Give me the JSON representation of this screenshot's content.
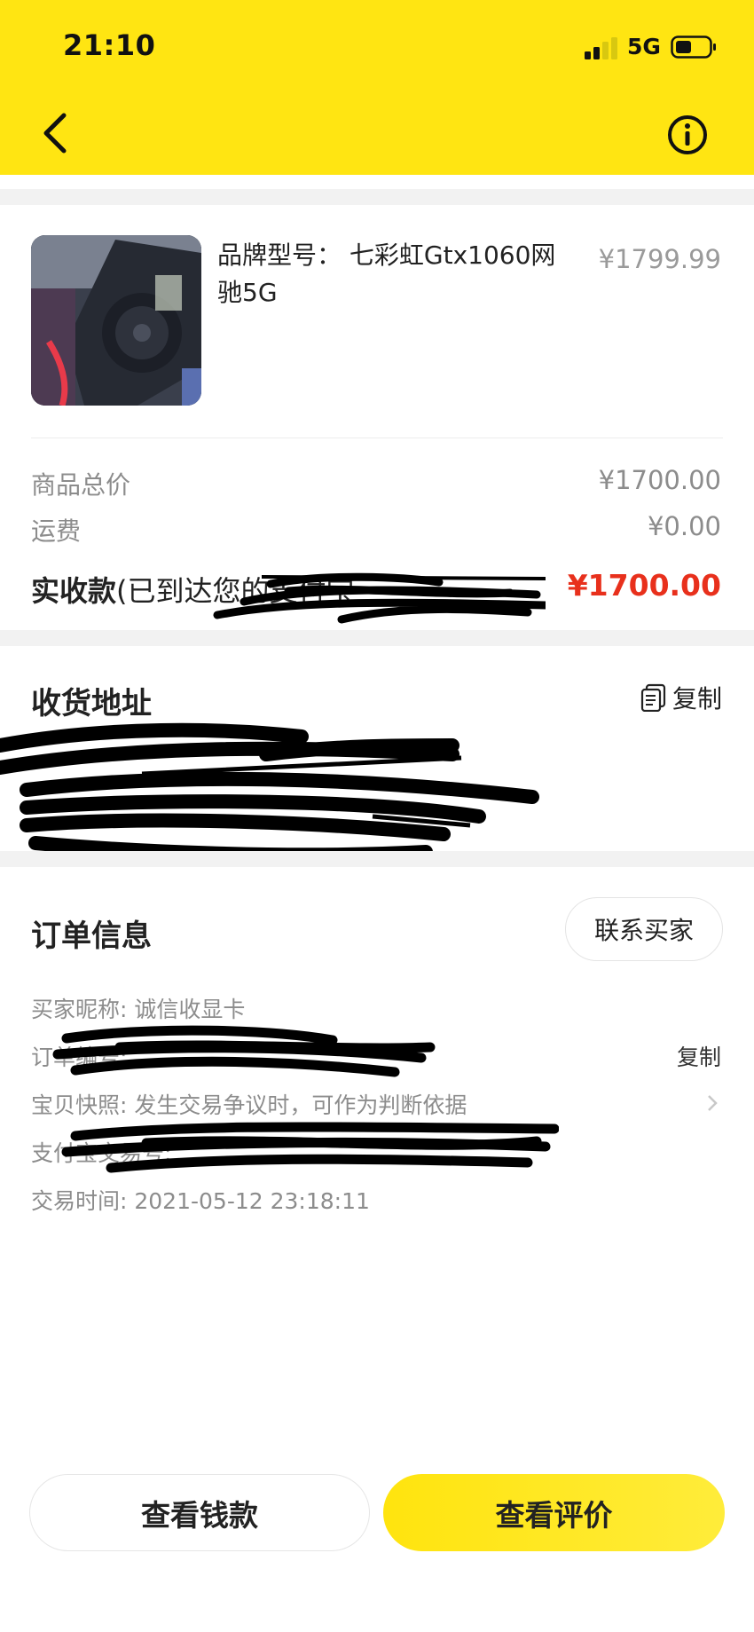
{
  "status_bar": {
    "time": "21:10",
    "network": "5G"
  },
  "item": {
    "title": "品牌型号： 七彩虹Gtx1060网驰5G",
    "price": "¥1799.99"
  },
  "summary": {
    "total_label": "商品总价",
    "total_value": "¥1700.00",
    "shipping_label": "运费",
    "shipping_value": "¥0.00",
    "received_label": "实收款",
    "received_note": "(已到达您的支付宝",
    "received_value": "¥1700.00"
  },
  "address": {
    "title": "收货地址",
    "copy_label": "复制"
  },
  "order": {
    "title": "订单信息",
    "contact_label": "联系买家",
    "buyer_nick": "买家昵称: 诚信收显卡",
    "order_no_label": "订单编号:",
    "order_copy": "复制",
    "snapshot": "宝贝快照: 发生交易争议时，可作为判断依据",
    "alipay_label": "支付宝交易号:",
    "trade_time": "交易时间: 2021-05-12 23:18:11"
  },
  "actions": {
    "view_payment": "查看钱款",
    "view_review": "查看评价"
  },
  "colors": {
    "header": "#ffe512",
    "accent_red": "#e8301c",
    "link_blue": "#3aa0e8"
  }
}
